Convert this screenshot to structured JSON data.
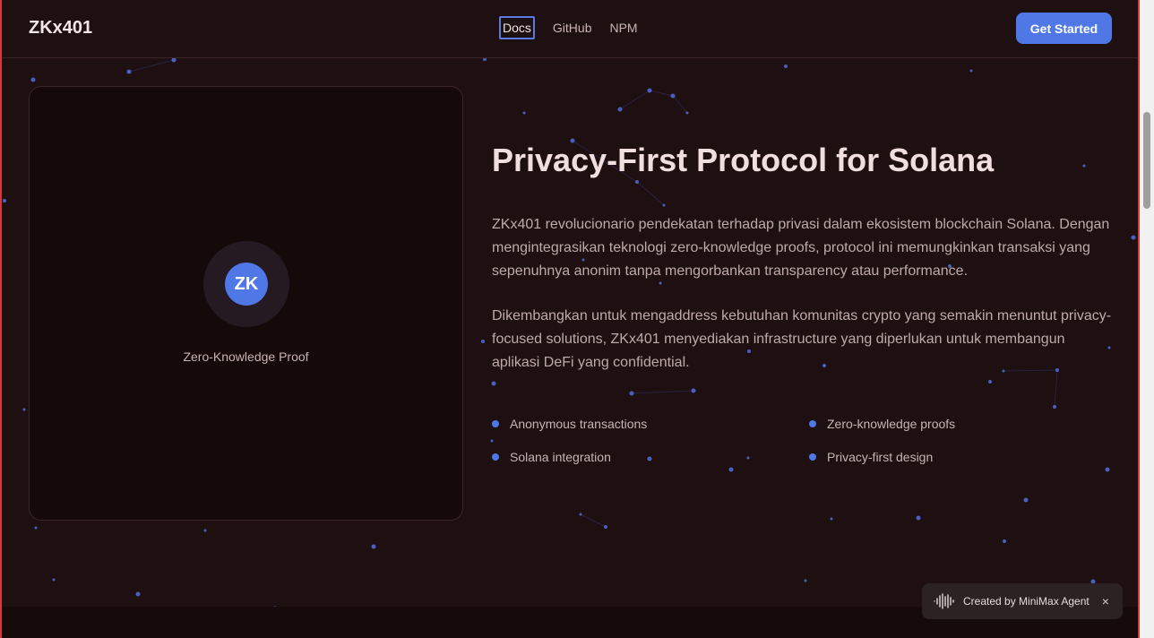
{
  "header": {
    "logo": "ZKx401",
    "nav": [
      "Docs",
      "GitHub",
      "NPM"
    ],
    "cta_label": "Get Started"
  },
  "card": {
    "badge": "ZK",
    "caption": "Zero-Knowledge Proof"
  },
  "main": {
    "title": "Privacy-First Protocol for Solana",
    "paragraph1": "ZKx401 revolucionario pendekatan terhadap privasi dalam ekosistem blockchain Solana. Dengan mengintegrasikan teknologi zero-knowledge proofs, protocol ini memungkinkan transaksi yang sepenuhnya anonim tanpa mengorbankan transparency atau performance.",
    "paragraph2": "Dikembangkan untuk mengaddress kebutuhan komunitas crypto yang semakin menuntut privacy-focused solutions, ZKx401 menyediakan infrastructure yang diperlukan untuk membangun aplikasi DeFi yang confidential.",
    "features": [
      "Anonymous transactions",
      "Zero-knowledge proofs",
      "Solana integration",
      "Privacy-first design"
    ]
  },
  "toast": {
    "label": "Created by MiniMax Agent",
    "close": "×"
  },
  "colors": {
    "accent": "#4f78e6",
    "background": "#1e1011",
    "card": "#150909"
  },
  "icons": {
    "toast": "waveform-icon",
    "close": "close-icon",
    "feature": "bullet-dot-icon"
  }
}
